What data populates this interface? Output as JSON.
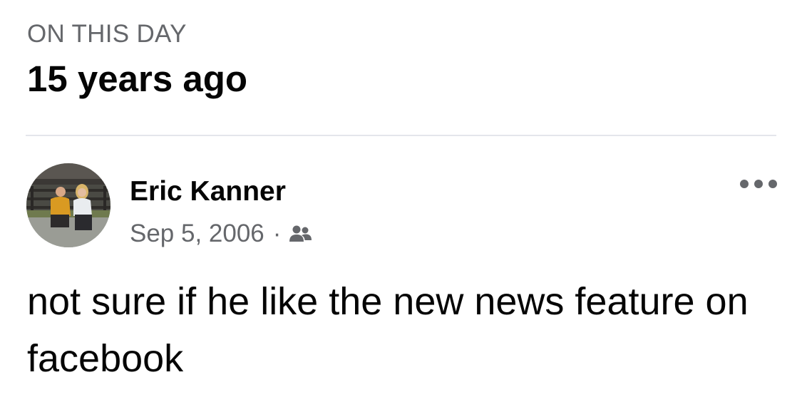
{
  "memory": {
    "section_label": "ON THIS DAY",
    "title": "15 years ago"
  },
  "post": {
    "author_name": "Eric Kanner",
    "date": "Sep 5, 2006",
    "separator": "·",
    "audience_icon": "friends-icon",
    "menu_icon": "more-options-icon",
    "text": "not sure if he like the new news feature on facebook"
  },
  "colors": {
    "primary_text": "#050505",
    "secondary_text": "#65676b",
    "divider": "#e4e6eb",
    "icon": "#65676b"
  }
}
